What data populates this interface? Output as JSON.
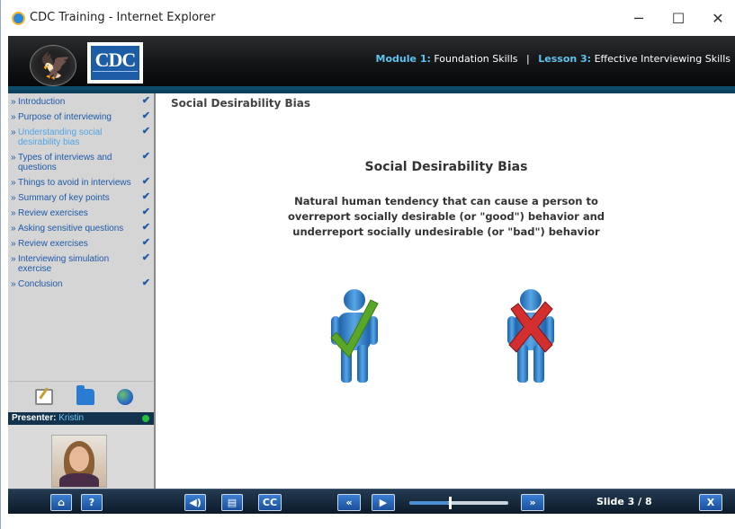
{
  "window": {
    "title": "CDC Training - Internet Explorer",
    "minimize": "─",
    "maximize": "☐",
    "close": "✕"
  },
  "header": {
    "module_label": "Module 1:",
    "module_name": "Foundation Skills",
    "separator": "|",
    "lesson_label": "Lesson 3:",
    "lesson_name": "Effective Interviewing Skills",
    "logo_text": "CDC"
  },
  "sidebar": {
    "bullet": "»",
    "check": "✔",
    "items": [
      {
        "label": "Introduction",
        "active": false
      },
      {
        "label": "Purpose of interviewing",
        "active": false
      },
      {
        "label": "Understanding social desirability bias",
        "active": true
      },
      {
        "label": "Types of interviews and questions",
        "active": false
      },
      {
        "label": "Things to avoid in interviews",
        "active": false
      },
      {
        "label": "Summary of key points",
        "active": false
      },
      {
        "label": "Review exercises",
        "active": false
      },
      {
        "label": "Asking sensitive questions",
        "active": false
      },
      {
        "label": "Review exercises",
        "active": false
      },
      {
        "label": "Interviewing simulation exercise",
        "active": false
      },
      {
        "label": "Conclusion",
        "active": false
      }
    ],
    "tools": [
      "notes-icon",
      "folder-icon",
      "globe-icon"
    ],
    "presenter_label": "Presenter:",
    "presenter_name": "Kristin",
    "presenter_status_color": "#22c23a"
  },
  "content": {
    "heading": "Social Desirability Bias",
    "title": "Social Desirability Bias",
    "body": "Natural human tendency that can cause a person to overreport socially desirable (or \"good\") behavior and underreport socially undesirable (or \"bad\") behavior",
    "figures": [
      {
        "name": "person-checkmark-icon",
        "mark": "check",
        "mark_color": "#5aa626"
      },
      {
        "name": "person-x-icon",
        "mark": "x",
        "mark_color": "#d42f2f"
      }
    ]
  },
  "toolbar": {
    "home": "⌂",
    "help": "?",
    "audio": "◀)",
    "transcript": "▤",
    "cc": "CC",
    "prev": "«",
    "play": "▶",
    "next": "»",
    "slide_counter": "Slide 3 / 8",
    "exit": "X",
    "progress_fraction": 0.4
  },
  "colors": {
    "accent": "#1d5aa8",
    "header_label": "#5fc3f0",
    "toolbar_button": "#2a64b4"
  }
}
